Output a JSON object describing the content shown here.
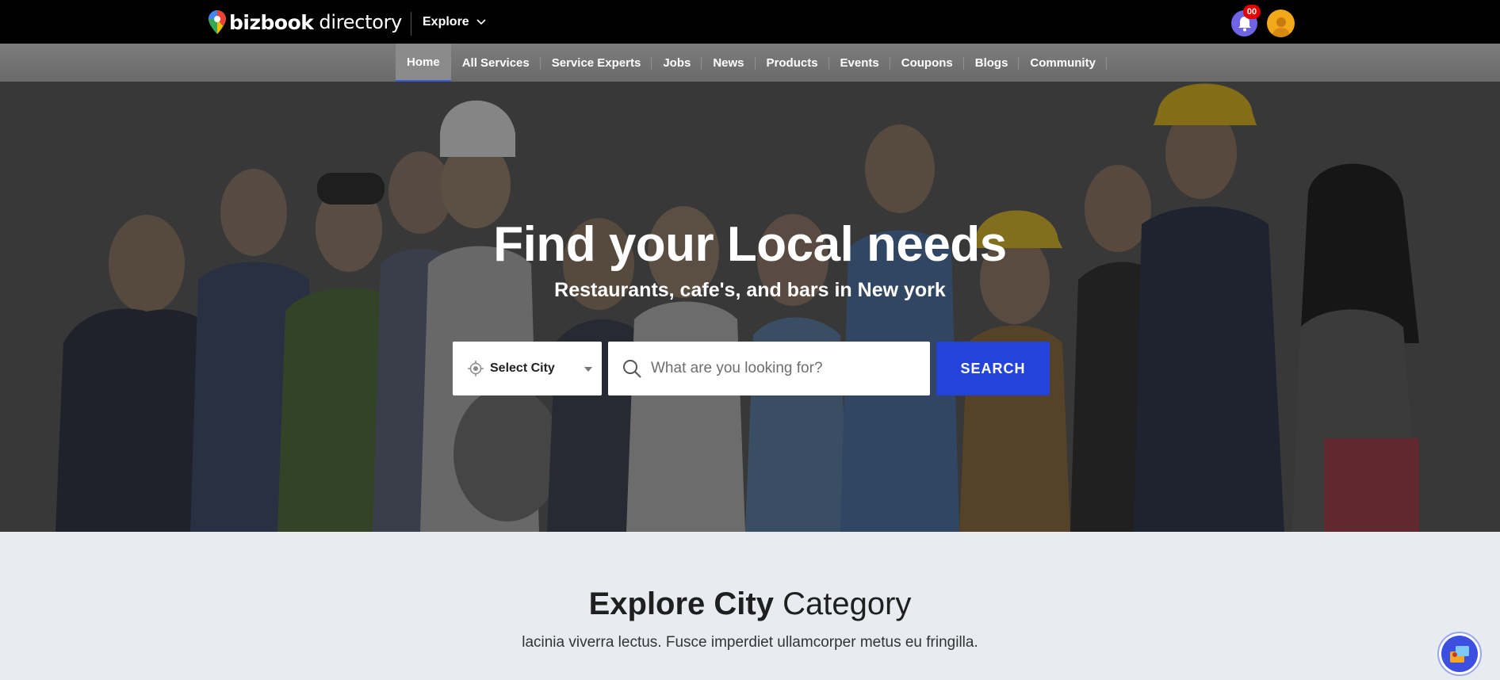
{
  "header": {
    "brand_bold": "bizbook",
    "brand_light": "directory",
    "explore_label": "Explore",
    "notification_count": "00",
    "icons": [
      "map-pin-icon",
      "chevron-down-icon",
      "bell-icon",
      "user-avatar"
    ]
  },
  "nav": {
    "items": [
      {
        "label": "Home",
        "active": true
      },
      {
        "label": "All Services"
      },
      {
        "label": "Service Experts"
      },
      {
        "label": "Jobs"
      },
      {
        "label": "News"
      },
      {
        "label": "Products"
      },
      {
        "label": "Events"
      },
      {
        "label": "Coupons"
      },
      {
        "label": "Blogs"
      },
      {
        "label": "Community"
      }
    ]
  },
  "hero": {
    "title": "Find your Local needs",
    "subtitle": "Restaurants, cafe's, and bars in New york",
    "city_select": "Select City",
    "search_placeholder": "What are you looking for?",
    "search_button": "SEARCH"
  },
  "explore": {
    "title_bold": "Explore City",
    "title_light": "Category",
    "subtitle": "lacinia viverra lectus. Fusce imperdiet ullamcorper metus eu fringilla."
  },
  "colors": {
    "accent": "#2343dc",
    "topbar": "#000000",
    "navbar": "#707070",
    "page_bg": "#e8ebf0"
  }
}
